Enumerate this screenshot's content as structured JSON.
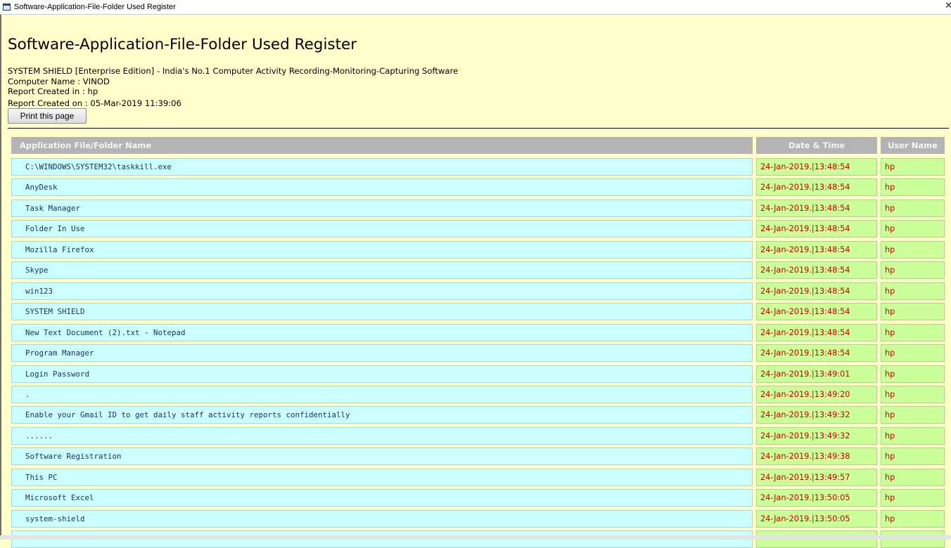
{
  "window": {
    "title": "Software-Application-File-Folder Used Register"
  },
  "report": {
    "title": "Software-Application-File-Folder Used Register",
    "product_line": "SYSTEM SHIELD [Enterprise Edition] - India's No.1 Computer Activity Recording-Monitoring-Capturing Software",
    "computer_name": "Computer Name : VINOD",
    "created_in": "Report Created in : hp",
    "created_on": "Report Created on : 05-Mar-2019 11:39:06",
    "print_button": "Print this page"
  },
  "table": {
    "columns": [
      "Application File/Folder Name",
      "Date & Time",
      "User Name"
    ],
    "rows": [
      {
        "name": "C:\\WINDOWS\\SYSTEM32\\taskkill.exe",
        "datetime": "24-Jan-2019.|13:48:54",
        "user": "hp"
      },
      {
        "name": "AnyDesk",
        "datetime": "24-Jan-2019.|13:48:54",
        "user": "hp"
      },
      {
        "name": "Task Manager",
        "datetime": "24-Jan-2019.|13:48:54",
        "user": "hp"
      },
      {
        "name": "Folder In Use",
        "datetime": "24-Jan-2019.|13:48:54",
        "user": "hp"
      },
      {
        "name": "Mozilla Firefox",
        "datetime": "24-Jan-2019.|13:48:54",
        "user": "hp"
      },
      {
        "name": "Skype",
        "datetime": "24-Jan-2019.|13:48:54",
        "user": "hp"
      },
      {
        "name": "win123",
        "datetime": "24-Jan-2019.|13:48:54",
        "user": "hp"
      },
      {
        "name": "SYSTEM SHIELD",
        "datetime": "24-Jan-2019.|13:48:54",
        "user": "hp"
      },
      {
        "name": "New Text Document (2).txt - Notepad",
        "datetime": "24-Jan-2019.|13:48:54",
        "user": "hp"
      },
      {
        "name": "Program Manager",
        "datetime": "24-Jan-2019.|13:48:54",
        "user": "hp"
      },
      {
        "name": "Login Password",
        "datetime": "24-Jan-2019.|13:49:01",
        "user": "hp"
      },
      {
        "name": ".",
        "datetime": "24-Jan-2019.|13:49:20",
        "user": "hp"
      },
      {
        "name": "Enable your Gmail ID to get daily staff activity reports confidentially",
        "datetime": "24-Jan-2019.|13:49:32",
        "user": "hp"
      },
      {
        "name": "......",
        "datetime": "24-Jan-2019.|13:49:32",
        "user": "hp"
      },
      {
        "name": "Software Registration",
        "datetime": "24-Jan-2019.|13:49:38",
        "user": "hp"
      },
      {
        "name": "This PC",
        "datetime": "24-Jan-2019.|13:49:57",
        "user": "hp"
      },
      {
        "name": "Microsoft Excel",
        "datetime": "24-Jan-2019.|13:50:05",
        "user": "hp"
      },
      {
        "name": "system-shield",
        "datetime": "24-Jan-2019.|13:50:05",
        "user": "hp"
      },
      {
        "name": "",
        "datetime": "",
        "user": ""
      }
    ]
  },
  "colors": {
    "page_background": "#ffffcc",
    "header_background": "#b4b4b4",
    "name_cell_background": "#ccffff",
    "date_user_cell_background": "#ccff99",
    "date_user_text": "#cc0000",
    "name_text": "#1a3070"
  },
  "icons": {
    "window_icon": "app-window-icon",
    "close": "close-icon"
  }
}
